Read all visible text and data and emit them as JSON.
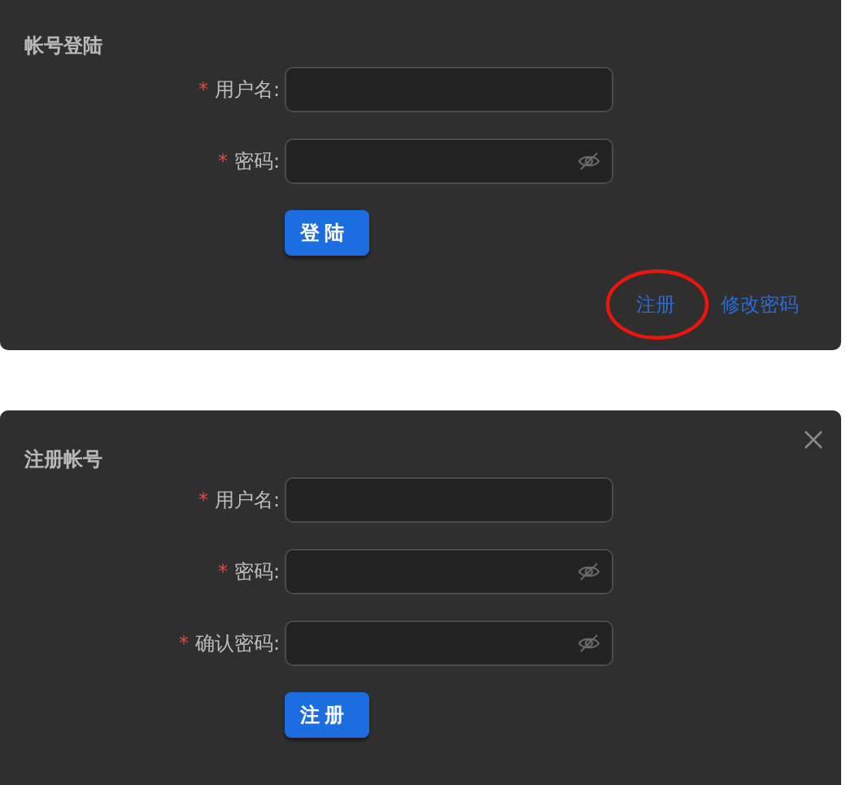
{
  "login_panel": {
    "title": "帐号登陆",
    "fields": [
      {
        "required_mark": "*",
        "label": "用户名:",
        "kind": "text"
      },
      {
        "required_mark": "*",
        "label": "密码:",
        "kind": "password"
      }
    ],
    "submit": "登陆",
    "links": [
      {
        "label": "注册",
        "circled": true
      },
      {
        "label": "修改密码",
        "circled": false
      }
    ]
  },
  "register_panel": {
    "title": "注册帐号",
    "fields": [
      {
        "required_mark": "*",
        "label": "用户名:",
        "kind": "text"
      },
      {
        "required_mark": "*",
        "label": "密码:",
        "kind": "password"
      },
      {
        "required_mark": "*",
        "label": "确认密码:",
        "kind": "password"
      }
    ],
    "submit": "注册"
  }
}
